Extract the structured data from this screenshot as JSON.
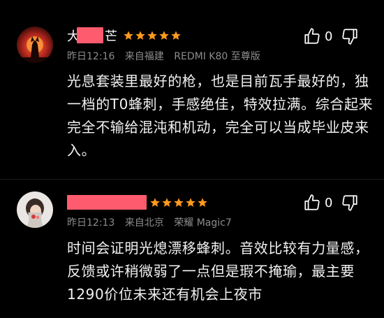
{
  "comments": [
    {
      "username_visible": "芒",
      "username_prefix": "大",
      "rating": 5,
      "time": "昨日12:16",
      "location": "来自福建",
      "device": "REDMI K80 至尊版",
      "text": "光息套装里最好的枪，也是目前瓦手最好的，独一档的T0蜂刺，手感绝佳，特效拉满。综合起来完全不输给混沌和机动，完全可以当成毕业皮来入。",
      "likes": "0"
    },
    {
      "username_visible": "",
      "rating": 5,
      "time": "昨日12:13",
      "location": "来自北京",
      "device": "荣耀 Magic7",
      "text": "时间会证明光熄漂移蜂刺。音效比较有力量感，反馈或许稍微弱了一点但是瑕不掩瑜，最主要1290价位未来还有机会上夜市",
      "likes": "0"
    }
  ],
  "colors": {
    "background": "#000000",
    "star": "#ff9a1e",
    "meta_text": "#8c8c8c",
    "redaction": "#ff5b6e"
  },
  "icons": {
    "like": "thumb-up-icon",
    "dislike": "thumb-down-icon",
    "star": "star-icon"
  }
}
